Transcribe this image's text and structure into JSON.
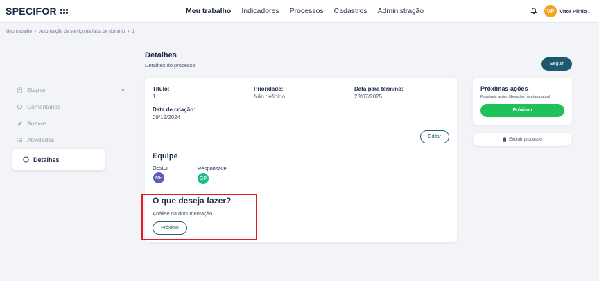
{
  "app": {
    "logo": "SPECIFOR"
  },
  "nav": {
    "items": [
      "Meu trabalho",
      "Indicadores",
      "Processos",
      "Cadastros",
      "Administração"
    ],
    "active": "Meu trabalho"
  },
  "user": {
    "initials": "VP",
    "name": "Vitor Plinio",
    "avatar_color": "#f6a21d"
  },
  "breadcrumb": {
    "items": [
      "Meu trabalho",
      "›",
      "Autorização de serviço na faixa de domínio",
      "›",
      "1"
    ]
  },
  "header": {
    "title": "Detalhes",
    "subtitle": "Detalhes do processo",
    "follow_label": "Seguir"
  },
  "sidebar": {
    "items": [
      {
        "label": "Etapas",
        "icon": "file-icon"
      },
      {
        "label": "Comentários",
        "icon": "chat-icon"
      },
      {
        "label": "Anexos",
        "icon": "paperclip-icon"
      },
      {
        "label": "Atividades",
        "icon": "list-icon"
      }
    ],
    "active": {
      "label": "Detalhes",
      "icon": "info-icon"
    }
  },
  "details": {
    "titulo_label": "Título:",
    "titulo_value": "1",
    "prioridade_label": "Prioridade:",
    "prioridade_value": "Não definido",
    "termino_label": "Data para término:",
    "termino_value": "23/07/2025",
    "criacao_label": "Data de criação:",
    "criacao_value": "09/12/2024",
    "edit_label": "Editar"
  },
  "team": {
    "title": "Equipe",
    "gestor_label": "Gestor",
    "gestor_initials": "MF",
    "gestor_color": "#5b5fb5",
    "responsavel_label": "Responsável",
    "responsavel_initials": "GP",
    "responsavel_color": "#22b98c"
  },
  "todo": {
    "title": "O que deseja fazer?",
    "description": "Análise da documentação",
    "button_label": "Próximo"
  },
  "next_actions": {
    "title": "Próximas ações",
    "subtitle": "Possíveis ações liberadas na etapa atual",
    "button_label": "Próximo",
    "delete_label": "Excluir processo"
  },
  "colors": {
    "accent": "#1f5670",
    "success": "#21c15a",
    "highlight": "#e11d1d"
  }
}
